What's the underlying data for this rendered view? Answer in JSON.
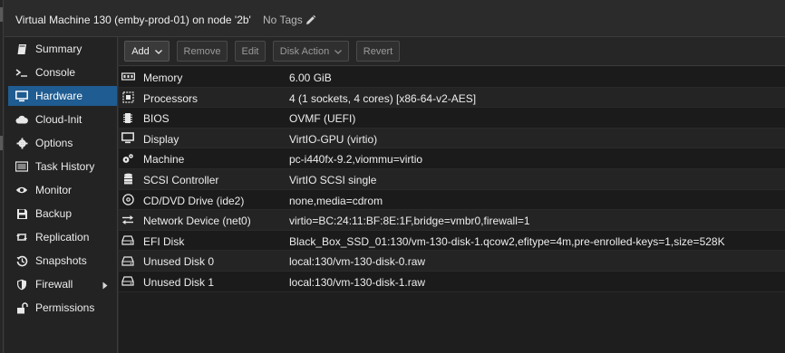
{
  "header": {
    "title": "Virtual Machine 130 (emby-prod-01) on node '2b'",
    "tags": "No Tags"
  },
  "sidebar": {
    "items": [
      {
        "label": "Summary",
        "icon": "book-icon"
      },
      {
        "label": "Console",
        "icon": "terminal-icon"
      },
      {
        "label": "Hardware",
        "icon": "monitor-icon",
        "active": true
      },
      {
        "label": "Cloud-Init",
        "icon": "cloud-icon"
      },
      {
        "label": "Options",
        "icon": "gear-icon"
      },
      {
        "label": "Task History",
        "icon": "list-icon"
      },
      {
        "label": "Monitor",
        "icon": "eye-icon"
      },
      {
        "label": "Backup",
        "icon": "floppy-icon"
      },
      {
        "label": "Replication",
        "icon": "retweet-icon"
      },
      {
        "label": "Snapshots",
        "icon": "history-icon"
      },
      {
        "label": "Firewall",
        "icon": "shield-icon"
      },
      {
        "label": "Permissions",
        "icon": "unlock-icon"
      }
    ]
  },
  "toolbar": {
    "add": "Add",
    "remove": "Remove",
    "edit": "Edit",
    "disk_action": "Disk Action",
    "revert": "Revert"
  },
  "hardware": {
    "rows": [
      {
        "label": "Memory",
        "value": "6.00 GiB",
        "icon": "memory-icon"
      },
      {
        "label": "Processors",
        "value": "4 (1 sockets, 4 cores) [x86-64-v2-AES]",
        "icon": "cpu-icon"
      },
      {
        "label": "BIOS",
        "value": "OVMF (UEFI)",
        "icon": "microchip-icon"
      },
      {
        "label": "Display",
        "value": "VirtIO-GPU (virtio)",
        "icon": "desktop-icon"
      },
      {
        "label": "Machine",
        "value": "pc-i440fx-9.2,viommu=virtio",
        "icon": "cogs-icon"
      },
      {
        "label": "SCSI Controller",
        "value": "VirtIO SCSI single",
        "icon": "database-icon"
      },
      {
        "label": "CD/DVD Drive (ide2)",
        "value": "none,media=cdrom",
        "icon": "cdrom-icon"
      },
      {
        "label": "Network Device (net0)",
        "value": "virtio=BC:24:11:BF:8E:1F,bridge=vmbr0,firewall=1",
        "icon": "exchange-icon"
      },
      {
        "label": "EFI Disk",
        "value": "Black_Box_SSD_01:130/vm-130-disk-1.qcow2,efitype=4m,pre-enrolled-keys=1,size=528K",
        "icon": "hdd-icon"
      },
      {
        "label": "Unused Disk 0",
        "value": "local:130/vm-130-disk-0.raw",
        "icon": "hdd-icon"
      },
      {
        "label": "Unused Disk 1",
        "value": "local:130/vm-130-disk-1.raw",
        "icon": "hdd-icon"
      }
    ]
  },
  "colors": {
    "active_nav": "#1f5c91",
    "background": "#1e1e1e",
    "text": "#ededed"
  }
}
